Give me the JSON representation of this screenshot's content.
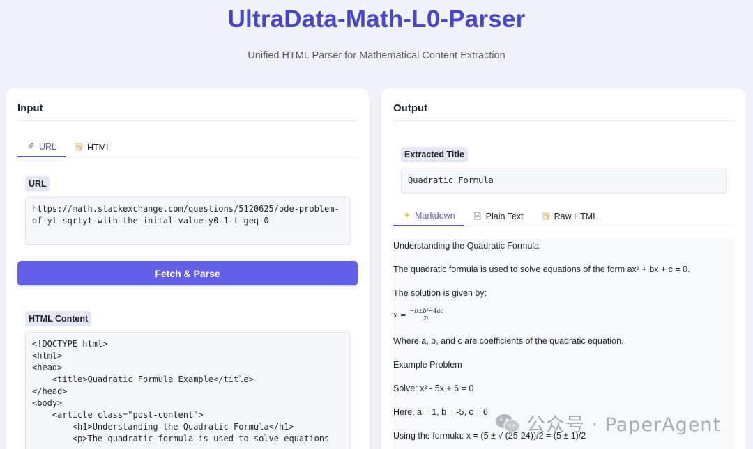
{
  "app": {
    "title": "UltraData-Math-L0-Parser",
    "subtitle": "Unified HTML Parser for Mathematical Content Extraction"
  },
  "input": {
    "heading": "Input",
    "tabs": [
      {
        "icon": "link-icon",
        "label": "URL",
        "active": true
      },
      {
        "icon": "memo-icon",
        "label": "HTML",
        "active": false
      }
    ],
    "url_label": "URL",
    "url_value": "https://math.stackexchange.com/questions/5120625/ode-problem-of-yt-sqrtyt-with-the-inital-value-y0-1-t-geq-0",
    "fetch_button": "Fetch & Parse",
    "html_label": "HTML Content",
    "html_value": "<!DOCTYPE html>\n<html>\n<head>\n    <title>Quadratic Formula Example</title>\n</head>\n<body>\n    <article class=\"post-content\">\n        <h1>Understanding the Quadratic Formula</h1>\n        <p>The quadratic formula is used to solve equations"
  },
  "output": {
    "heading": "Output",
    "title_label": "Extracted Title",
    "title_value": "Quadratic Formula",
    "tabs": [
      {
        "icon": "sparkles-icon",
        "label": "Markdown",
        "active": true
      },
      {
        "icon": "page-icon",
        "label": "Plain Text",
        "active": false
      },
      {
        "icon": "memo-icon",
        "label": "Raw HTML",
        "active": false
      }
    ],
    "markdown": {
      "lines": [
        "Understanding the Quadratic Formula",
        "The quadratic formula is used to solve equations of the form ax² + bx + c = 0.",
        "The solution is given by:",
        "Where a, b, and c are coefficients of the quadratic equation.",
        "Example Problem",
        "Solve: x² - 5x + 6 = 0",
        "Here, a = 1, b = -5, c = 6",
        "Using the formula: x = (5 ± √ (25-24))/2 = (5 ± 1)/2"
      ],
      "formula": {
        "lhs": "x =",
        "numerator": "−b±b²−4ac",
        "denominator": "2a"
      }
    }
  },
  "watermark": {
    "text": "公众号 · PaperAgent"
  },
  "colors": {
    "accent": "#5b57d6",
    "title": "#4a46c9",
    "button": "#6360e8",
    "chip": "#e4e7f6",
    "background": "#f1f3fa"
  }
}
